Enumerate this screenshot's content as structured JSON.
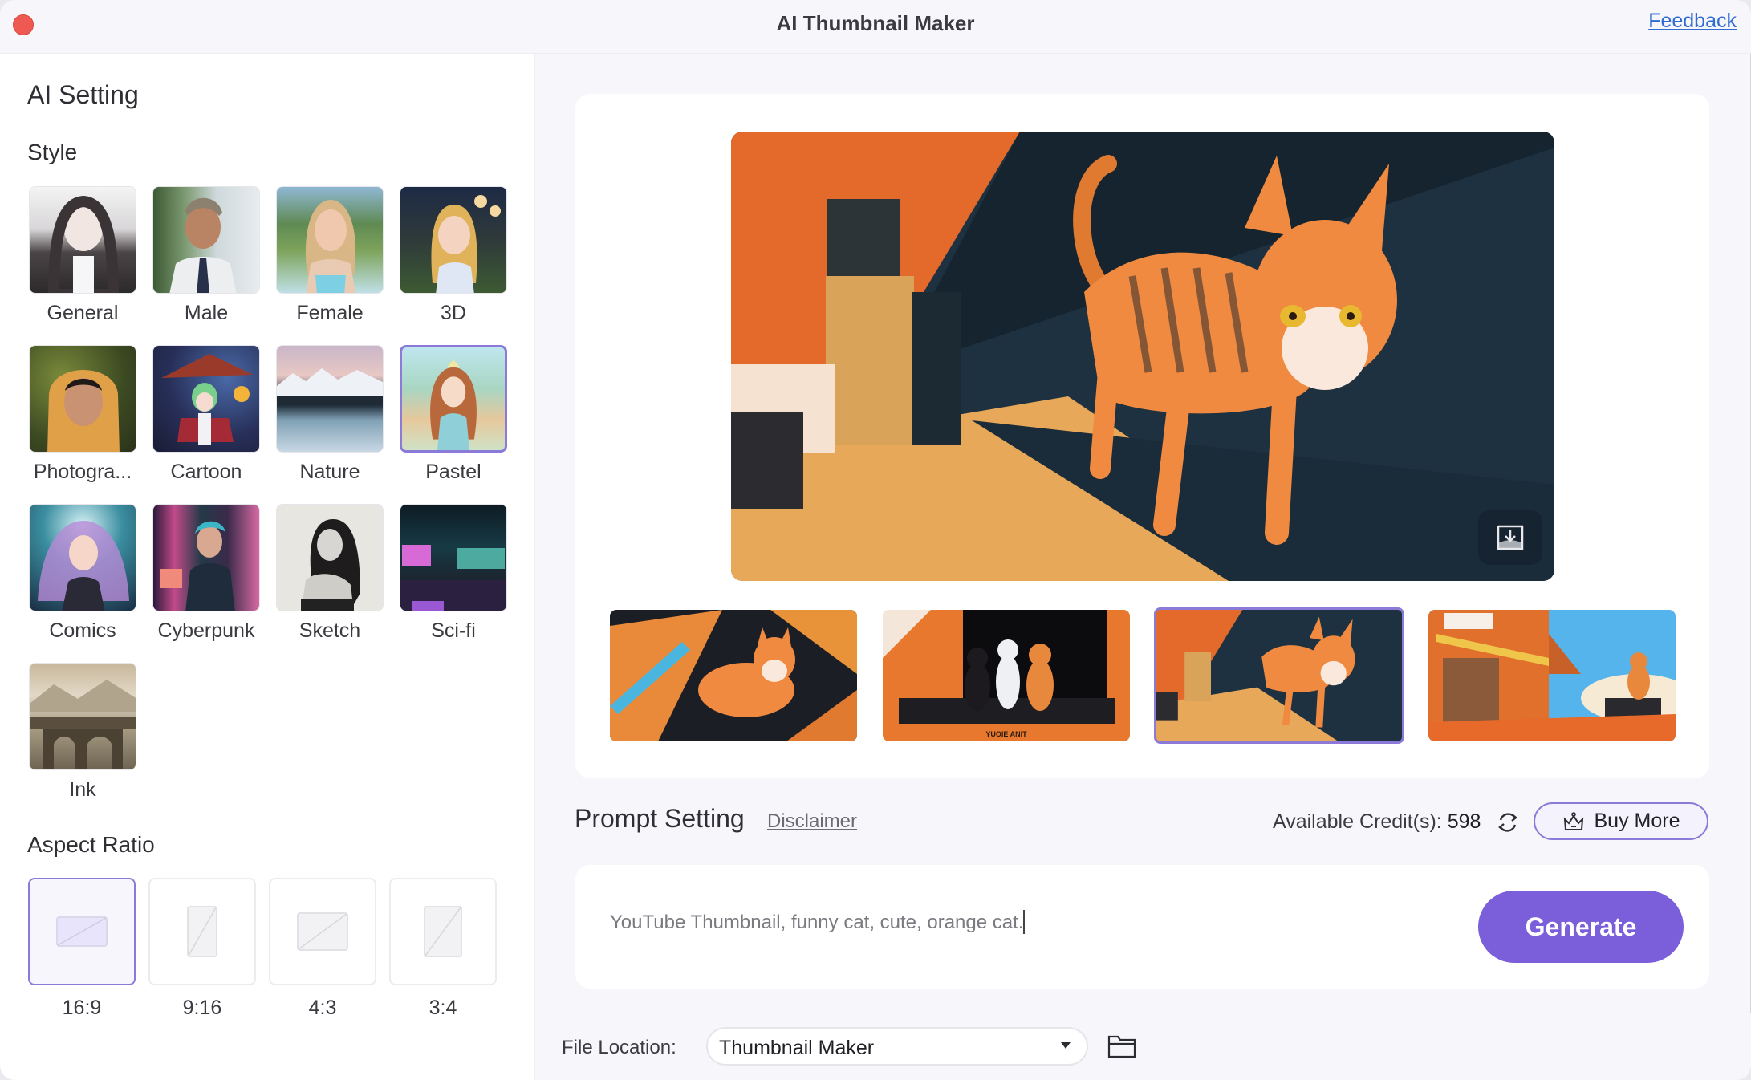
{
  "window": {
    "title": "AI Thumbnail Maker",
    "feedback_label": "Feedback"
  },
  "ai_setting": {
    "title": "AI Setting",
    "style_title": "Style",
    "styles": [
      {
        "label": "General",
        "selected": false
      },
      {
        "label": "Male",
        "selected": false
      },
      {
        "label": "Female",
        "selected": false
      },
      {
        "label": "3D",
        "selected": false
      },
      {
        "label": "Photogra...",
        "selected": false
      },
      {
        "label": "Cartoon",
        "selected": false
      },
      {
        "label": "Nature",
        "selected": false
      },
      {
        "label": "Pastel",
        "selected": true
      },
      {
        "label": "Comics",
        "selected": false
      },
      {
        "label": "Cyberpunk",
        "selected": false
      },
      {
        "label": "Sketch",
        "selected": false
      },
      {
        "label": "Sci-fi",
        "selected": false
      },
      {
        "label": "Ink",
        "selected": false
      }
    ],
    "aspect_title": "Aspect Ratio",
    "aspects": [
      {
        "label": "16:9",
        "selected": true
      },
      {
        "label": "9:16",
        "selected": false
      },
      {
        "label": "4:3",
        "selected": false
      },
      {
        "label": "3:4",
        "selected": false
      }
    ]
  },
  "preview": {
    "main_image_alt": "orange tabby cat walking in a room, anime style",
    "download_icon": "download-tray-icon",
    "thumbnails": [
      {
        "alt": "orange cat on dark geometric stairs",
        "selected": false
      },
      {
        "alt": "three cats (black, white, orange) on a stand, text YUOIE ANIT",
        "selected": false
      },
      {
        "alt": "orange tabby cat walking in a room",
        "selected": true
      },
      {
        "alt": "orange cat sitting by a wooden shop under blue sky",
        "selected": false
      }
    ],
    "thumb_caption_text": "YUOIE ANIT"
  },
  "prompt": {
    "title": "Prompt Setting",
    "disclaimer_label": "Disclaimer",
    "credits_label": "Available Credit(s):",
    "credits_value": "598",
    "buy_more_label": "Buy More",
    "input_value": "YouTube Thumbnail, funny cat, cute, orange cat.",
    "generate_label": "Generate"
  },
  "footer": {
    "file_location_label": "File Location:",
    "file_location_value": "Thumbnail Maker"
  },
  "colors": {
    "accent": "#7b5ed9",
    "selected_border": "#8c7ad9",
    "link": "#2f6bd1",
    "close": "#ee5a52"
  }
}
